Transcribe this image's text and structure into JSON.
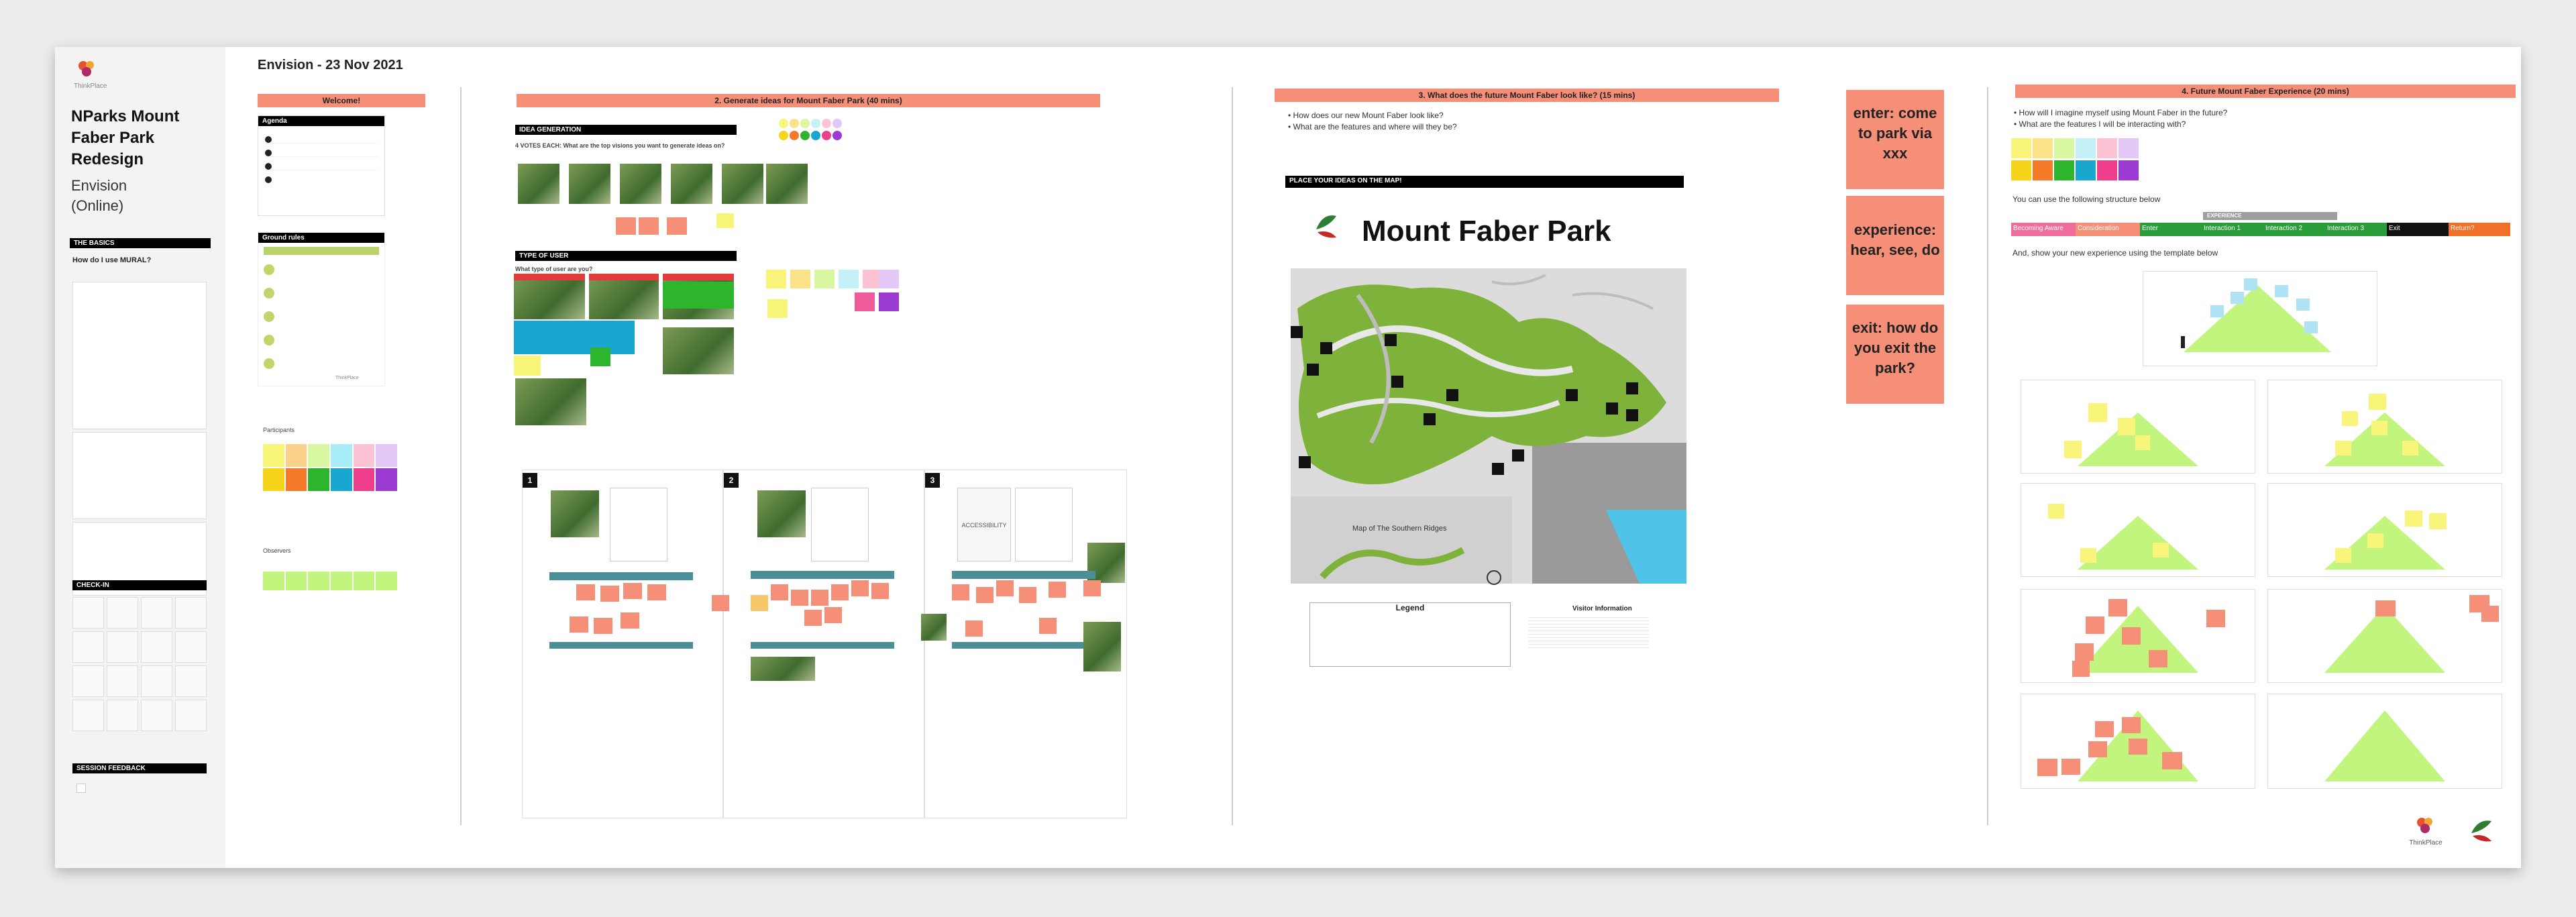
{
  "sidebar": {
    "logo_text": "ThinkPlace",
    "title": "NParks Mount Faber Park Redesign",
    "subtitle": "Envision (Online)",
    "basics_bar": "THE BASICS",
    "how_to_use": "How do I use MURAL?",
    "checkin_bar": "CHECK-IN",
    "session_feedback_bar": "SESSION FEEDBACK"
  },
  "board": {
    "title": "Envision - 23 Nov 2021",
    "welcome": "Welcome!",
    "agenda_label": "Agenda",
    "ground_rules_label": "Ground rules",
    "participants_label": "Participants",
    "observers_label": "Observers",
    "section2_title": "2. Generate ideas for Mount Faber Park (40 mins)",
    "idea_generation_bar": "IDEA GENERATION",
    "idea_question": "4 VOTES EACH: What are the top visions you want to generate ideas on?",
    "type_of_user_bar": "TYPE OF USER",
    "type_of_user_q": "What type of user are you?",
    "section3_title": "3. What does the future Mount Faber look like? (15 mins)",
    "section3_bullets": [
      "How does our new Mount Faber look like?",
      "What are the features and where will they be?"
    ],
    "place_ideas_bar": "PLACE YOUR IDEAS ON THE MAP!",
    "map_title": "Mount Faber Park",
    "map_subtitle": "Map of The Southern Ridges",
    "legend_label": "Legend",
    "visitor_info": "Visitor Information",
    "enter_card": "enter: come to park via xxx",
    "experience_card": "experience: hear, see, do",
    "exit_card": "exit: how do you exit the park?",
    "section4_title": "4. Future Mount Faber Experience (20 mins)",
    "section4_bullets": [
      "How will I imagine myself using Mount Faber in the future?",
      "What are the features I will be interacting with?"
    ],
    "structure_text": "You can use the following structure below",
    "experience_header": "EXPERIENCE",
    "journey_steps": [
      "Becoming Aware",
      "Consideration",
      "Enter",
      "Interaction 1",
      "Interaction 2",
      "Interaction 3",
      "Exit",
      "Return?"
    ],
    "template_text": "And, show your new experience using the template below",
    "frame_numbers": [
      "1",
      "2",
      "3"
    ],
    "accessibility_text": "ACCESSIBILITY",
    "footer_logo": "ThinkPlace"
  },
  "colors": {
    "salmon": "#f58f78",
    "green_triangle": "#c1f57d",
    "teal": "#4a8f98",
    "journey": [
      "#f06c9b",
      "#f58f78",
      "#2a9d3a",
      "#2a9d3a",
      "#2a9d3a",
      "#2a9d3a",
      "#111111",
      "#f0702a"
    ]
  }
}
